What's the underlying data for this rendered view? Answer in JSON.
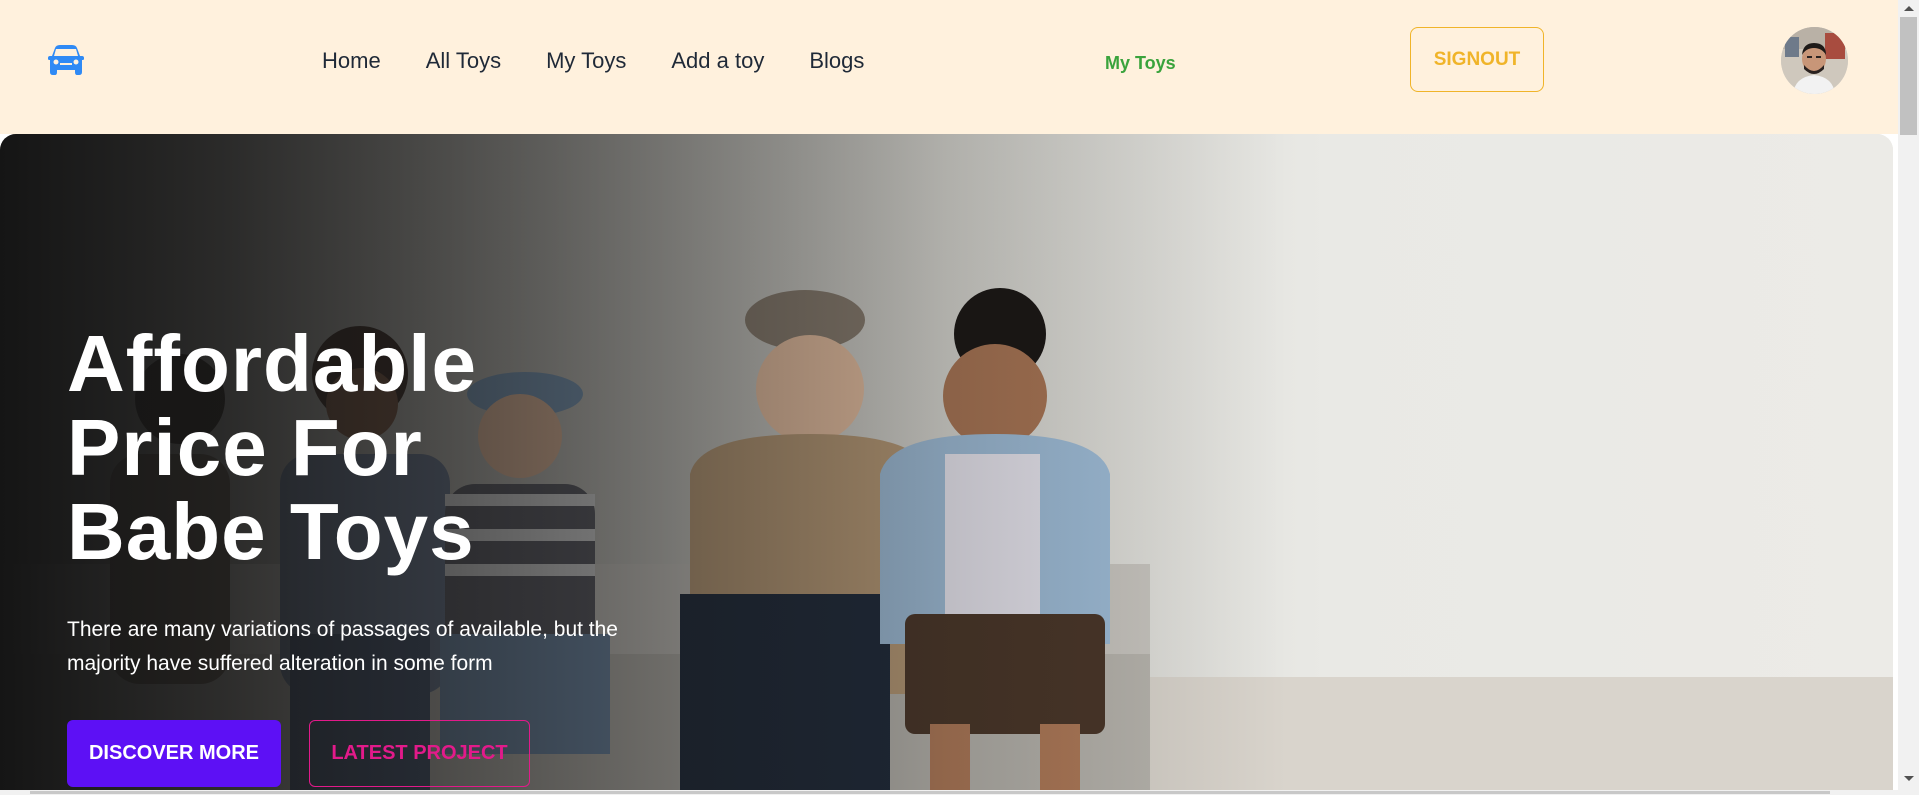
{
  "navbar": {
    "logo_icon": "car-icon",
    "logo_color": "#2f8af5",
    "background": "#fff1dd",
    "links": [
      {
        "label": "Home"
      },
      {
        "label": "All Toys"
      },
      {
        "label": "My Toys"
      },
      {
        "label": "Add a toy"
      },
      {
        "label": "Blogs"
      }
    ],
    "active_label": "My Toys",
    "active_color": "#3aa33c",
    "signout_label": "SIGNOUT",
    "signout_color": "#f0b429",
    "avatar_icon": "user-avatar"
  },
  "hero": {
    "title_lines": [
      "Affordable",
      "Price For",
      "Babe Toys"
    ],
    "subtitle_lines": [
      "There are many variations of passages of available, but the",
      "majority have suffered alteration in some form"
    ],
    "primary_button": {
      "label": "DISCOVER MORE",
      "color": "#5d10f5"
    },
    "secondary_button": {
      "label": "LATEST PROJECT",
      "color": "#e21a8a"
    },
    "image_icon": "children-photo"
  }
}
